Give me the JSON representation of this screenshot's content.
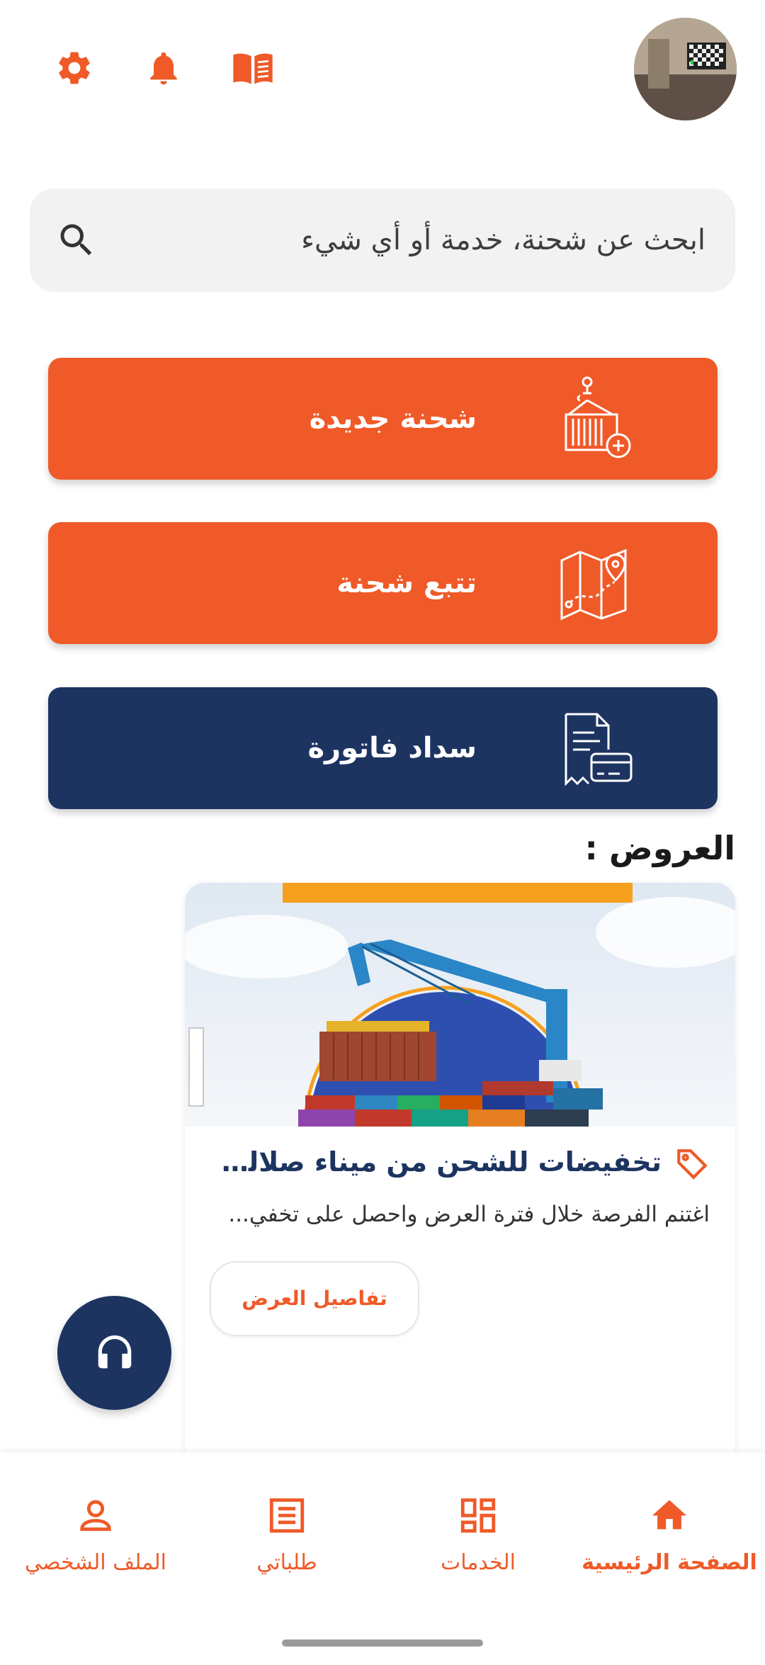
{
  "header": {
    "icons": [
      "settings-icon",
      "bell-icon",
      "book-icon"
    ],
    "avatar": "user-avatar",
    "accent_color": "#ef5a28"
  },
  "search": {
    "placeholder": "ابحث عن شحنة، خدمة أو أي شيء"
  },
  "actions": [
    {
      "label": "شحنة جديدة",
      "icon": "container-crane-plus-icon",
      "color": "#ef5a28"
    },
    {
      "label": "تتبع شحنة",
      "icon": "map-pin-route-icon",
      "color": "#ef5a28"
    },
    {
      "label": "سداد فاتورة",
      "icon": "invoice-card-icon",
      "color": "#1d3461"
    }
  ],
  "offers": {
    "title": "العروض :",
    "items": [
      {
        "title": "تخفيضات للشحن من ميناء صلالة ا...",
        "description": "اغتنم الفرصة خلال فترة العرض واحصل على تخفي...",
        "button": "تفاصيل العرض",
        "image": "port-crane-containers-image"
      }
    ]
  },
  "fab": {
    "icon": "headset-icon"
  },
  "bottom_nav": {
    "items": [
      {
        "label": "الصفحة الرئيسية",
        "icon": "home-icon",
        "active": true
      },
      {
        "label": "الخدمات",
        "icon": "grid-icon",
        "active": false
      },
      {
        "label": "طلباتي",
        "icon": "list-document-icon",
        "active": false
      },
      {
        "label": "الملف الشخصي",
        "icon": "user-icon",
        "active": false
      }
    ]
  }
}
